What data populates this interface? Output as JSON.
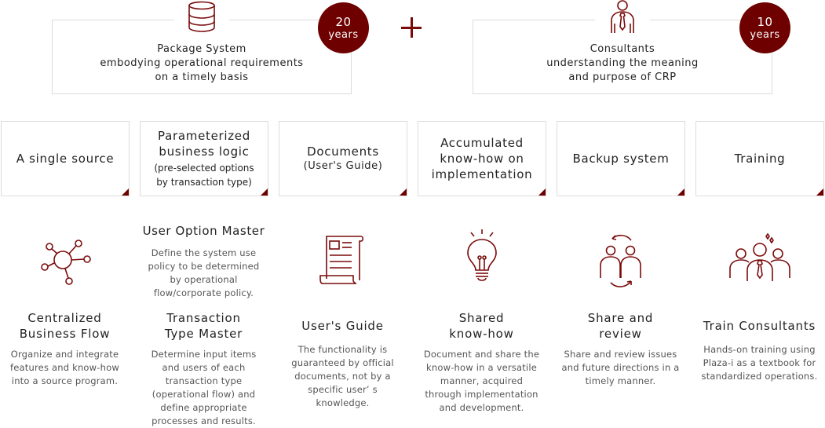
{
  "colors": {
    "accent": "#6e0000",
    "icon": "#7a0b0b",
    "border": "#dcdcdc",
    "text": "#222222",
    "muted": "#555555"
  },
  "top": {
    "left": {
      "icon": "database-icon",
      "lines": [
        "Package System",
        "embodying operational requirements",
        "on a timely basis"
      ],
      "badge_num": "20",
      "badge_unit": "years"
    },
    "plus": "+",
    "right": {
      "icon": "consultant-icon",
      "lines": [
        "Consultants",
        "understanding the meaning",
        "and purpose of CRP"
      ],
      "badge_num": "10",
      "badge_unit": "years"
    }
  },
  "features": [
    {
      "main": [
        "A single source"
      ],
      "sub": []
    },
    {
      "main": [
        "Parameterized",
        "business logic"
      ],
      "sub": [
        "(pre-selected options",
        "by transaction type)"
      ]
    },
    {
      "main": [
        "Documents"
      ],
      "sub_main": "(User's Guide)"
    },
    {
      "main": [
        "Accumulated",
        "know-how on",
        "implementation"
      ]
    },
    {
      "main": [
        "Backup system"
      ]
    },
    {
      "main": [
        "Training"
      ]
    }
  ],
  "columns": [
    {
      "icon": "network-hub-icon",
      "title": [
        "Centralized",
        "Business Flow"
      ],
      "desc": [
        "Organize and integrate",
        "features and know-how",
        "into a source program."
      ]
    },
    {
      "extra_title": "User Option Master",
      "extra_desc": [
        "Define the system use",
        "policy to be determined",
        "by operational",
        "flow/corporate policy."
      ],
      "title": [
        "Transaction",
        "Type Master"
      ],
      "desc": [
        "Determine input items",
        "and users of each",
        "transaction type",
        "(operational flow) and",
        "define appropriate",
        "processes and results."
      ]
    },
    {
      "icon": "document-scroll-icon",
      "title": [
        "User's Guide"
      ],
      "desc": [
        "The functionality is",
        "guaranteed by official",
        "documents, not by a",
        "specific user’ s",
        "knowledge."
      ]
    },
    {
      "icon": "lightbulb-icon",
      "title": [
        "Shared",
        "know-how"
      ],
      "desc": [
        "Document and share the",
        "know-how in a versatile",
        "manner, acquired",
        "through implementation",
        "and development."
      ]
    },
    {
      "icon": "share-review-icon",
      "title": [
        "Share and",
        "review"
      ],
      "desc": [
        "Share and review issues",
        "and future directions in a",
        "timely manner."
      ]
    },
    {
      "icon": "team-training-icon",
      "title": [
        "Train Consultants"
      ],
      "desc": [
        "Hands-on training using",
        "Plaza-i as a textbook for",
        "standardized operations."
      ]
    }
  ]
}
